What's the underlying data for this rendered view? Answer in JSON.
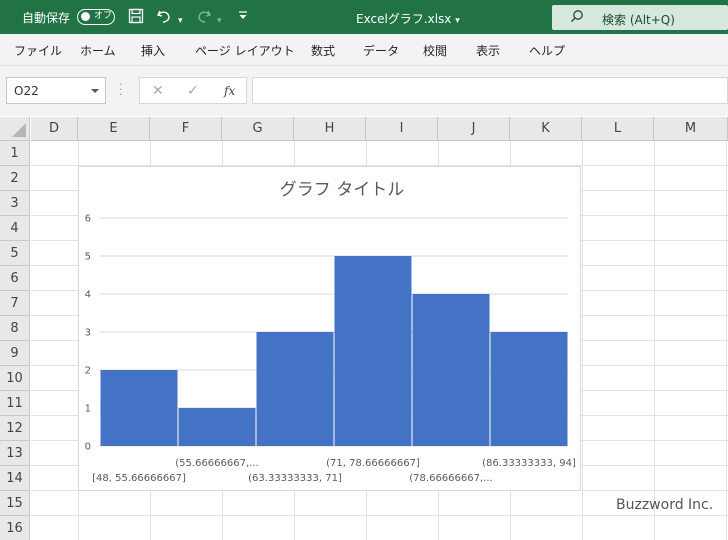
{
  "titlebar": {
    "autosave_label": "自動保存",
    "autosave_state": "オフ",
    "filename": "Excelグラフ.xlsx",
    "search_label": "検索 (Alt+Q)"
  },
  "ribbon": {
    "tabs": [
      "ファイル",
      "ホーム",
      "挿入",
      "ページ レイアウト",
      "数式",
      "データ",
      "校閲",
      "表示",
      "ヘルプ"
    ]
  },
  "formula_bar": {
    "name_box": "O22",
    "formula": ""
  },
  "grid": {
    "columns": [
      "D",
      "E",
      "F",
      "G",
      "H",
      "I",
      "J",
      "K",
      "L",
      "M"
    ],
    "rows": [
      "1",
      "2",
      "3",
      "4",
      "5",
      "6",
      "7",
      "8",
      "9",
      "10",
      "11",
      "12",
      "13",
      "14",
      "15",
      "16"
    ]
  },
  "chart_data": {
    "type": "bar",
    "title": "グラフ タイトル",
    "categories": [
      "[48, 55.66666667]",
      "(55.66666667,...",
      "(63.33333333, 71]",
      "(71, 78.66666667]",
      "(78.66666667,...",
      "(86.33333333, 94]"
    ],
    "values": [
      2,
      1,
      3,
      5,
      4,
      3
    ],
    "ylim": [
      0,
      6
    ],
    "yticks": [
      "0",
      "1",
      "2",
      "3",
      "4",
      "5",
      "6"
    ],
    "xlabel": "",
    "ylabel": "",
    "bar_color": "#4472c4",
    "gridlines": true
  },
  "watermark": "Buzzword Inc.",
  "colors": {
    "title_bar": "#217346",
    "ribbon": "#f3f3f3",
    "bar": "#4472c4"
  }
}
